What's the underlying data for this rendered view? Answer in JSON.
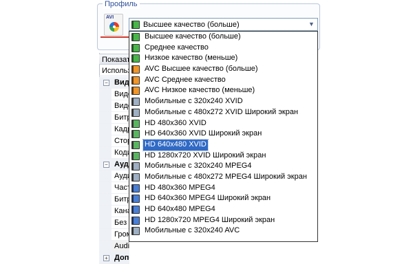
{
  "profile": {
    "group_title": "Профиль",
    "icon": "avi-file-icon",
    "icon_text": "AVI",
    "selected_value": "Высшее качество (больше)"
  },
  "left_panel": {
    "tab_label": "Показать",
    "subheader": "Использовать",
    "rows": [
      {
        "kind": "group",
        "expander": "⊟",
        "label": "Видео"
      },
      {
        "kind": "item",
        "label": "Видеокодек"
      },
      {
        "kind": "item",
        "label": "Видеоразмер"
      },
      {
        "kind": "item",
        "label": "Битрейт"
      },
      {
        "kind": "item",
        "label": "Кадров"
      },
      {
        "kind": "item",
        "label": "Стороны"
      },
      {
        "kind": "item",
        "label": "Кодирование"
      },
      {
        "kind": "group",
        "expander": "⊟",
        "label": "Аудио"
      },
      {
        "kind": "item",
        "label": "Аудиокодек"
      },
      {
        "kind": "item",
        "label": "Частота"
      },
      {
        "kind": "item",
        "label": "Битрейт"
      },
      {
        "kind": "item",
        "label": "Каналы"
      },
      {
        "kind": "item",
        "label": "Без звука"
      },
      {
        "kind": "item",
        "label": "Громкость"
      },
      {
        "kind": "item",
        "label": "Audio",
        "highlight": true
      },
      {
        "kind": "group",
        "expander": "⊞",
        "label": "Допол"
      }
    ]
  },
  "dropdown": {
    "options": [
      {
        "label": "Высшее качество (больше)",
        "icon": "green"
      },
      {
        "label": "Среднее качество",
        "icon": "green"
      },
      {
        "label": "Низкое качество (меньше)",
        "icon": "green"
      },
      {
        "label": "AVC Высшее качество (больше)",
        "icon": "orange"
      },
      {
        "label": "AVC Среднее качество",
        "icon": "orange"
      },
      {
        "label": "AVC Низкое качество (меньше)",
        "icon": "orange"
      },
      {
        "label": "Мобильные с 320x240 XVID",
        "icon": "gray"
      },
      {
        "label": "Мобильные с 480x272 XVID Широкий экран",
        "icon": "gray"
      },
      {
        "label": "HD 480x360 XVID",
        "icon": "gray-green"
      },
      {
        "label": "HD 640x360 XVID Широкий экран",
        "icon": "gray-green"
      },
      {
        "label": "HD 640x480 XVID",
        "icon": "gray-green",
        "selected": true
      },
      {
        "label": "HD 1280x720 XVID Широкий экран",
        "icon": "gray-green"
      },
      {
        "label": "Мобильные с 320x240 MPEG4",
        "icon": "gray"
      },
      {
        "label": "Мобильные с 480x272 MPEG4 Широкий экран",
        "icon": "gray"
      },
      {
        "label": "HD 480x360 MPEG4",
        "icon": "blue"
      },
      {
        "label": "HD 640x360 MPEG4 Широкий экран",
        "icon": "blue"
      },
      {
        "label": "HD 640x480 MPEG4",
        "icon": "blue"
      },
      {
        "label": "HD 1280x720 MPEG4 Широкий экран",
        "icon": "blue"
      },
      {
        "label": "Мобильные с 320x240 AVC",
        "icon": "gray"
      }
    ]
  },
  "colors": {
    "selection": "#316ac5",
    "group_border": "#b9c7dc",
    "accent_line": "#d23a2f"
  }
}
